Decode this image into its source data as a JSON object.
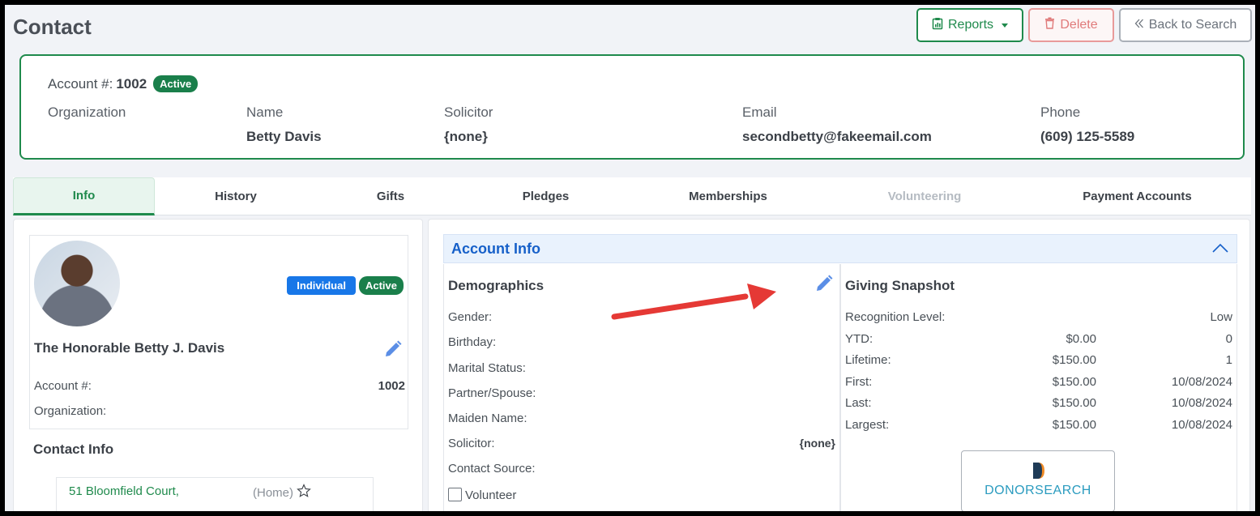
{
  "page": {
    "title": "Contact"
  },
  "toolbar": {
    "reports_label": "Reports",
    "delete_label": "Delete",
    "back_label": "Back to Search"
  },
  "summary": {
    "account_label": "Account #:",
    "account_number": "1002",
    "status_badge": "Active",
    "organization_label": "Organization",
    "name_label": "Name",
    "name_value": "Betty Davis",
    "solicitor_label": "Solicitor",
    "solicitor_value": "{none}",
    "email_label": "Email",
    "email_value": "secondbetty@fakeemail.com",
    "phone_label": "Phone",
    "phone_value": "(609) 125-5589"
  },
  "tabs": [
    {
      "label": "Info"
    },
    {
      "label": "History"
    },
    {
      "label": "Gifts"
    },
    {
      "label": "Pledges"
    },
    {
      "label": "Memberships"
    },
    {
      "label": "Volunteering"
    },
    {
      "label": "Payment Accounts"
    }
  ],
  "profile": {
    "type_badge": "Individual",
    "status_badge": "Active",
    "full_name": "The Honorable Betty J. Davis",
    "account_label": "Account #:",
    "account_value": "1002",
    "organization_label": "Organization:",
    "contact_info_title": "Contact Info",
    "address_line": "51 Bloomfield Court,",
    "address_type": "(Home)"
  },
  "account_info": {
    "title": "Account Info",
    "demographics": {
      "title": "Demographics",
      "gender_label": "Gender:",
      "birthday_label": "Birthday:",
      "marital_label": "Marital Status:",
      "partner_label": "Partner/Spouse:",
      "maiden_label": "Maiden Name:",
      "solicitor_label": "Solicitor:",
      "solicitor_value": "{none}",
      "source_label": "Contact Source:",
      "volunteer_label": "Volunteer"
    },
    "giving": {
      "title": "Giving Snapshot",
      "recognition_label": "Recognition Level:",
      "recognition_value": "Low",
      "rows": [
        {
          "label": "YTD:",
          "amount": "$0.00",
          "extra": "0"
        },
        {
          "label": "Lifetime:",
          "amount": "$150.00",
          "extra": "1"
        },
        {
          "label": "First:",
          "amount": "$150.00",
          "extra": "10/08/2024"
        },
        {
          "label": "Last:",
          "amount": "$150.00",
          "extra": "10/08/2024"
        },
        {
          "label": "Largest:",
          "amount": "$150.00",
          "extra": "10/08/2024"
        }
      ],
      "donorsearch_label": "DONORSEARCH"
    }
  },
  "colors": {
    "accent_green": "#1f8a4c",
    "accent_blue": "#1660c9",
    "annotation_arrow": "#e53935"
  }
}
